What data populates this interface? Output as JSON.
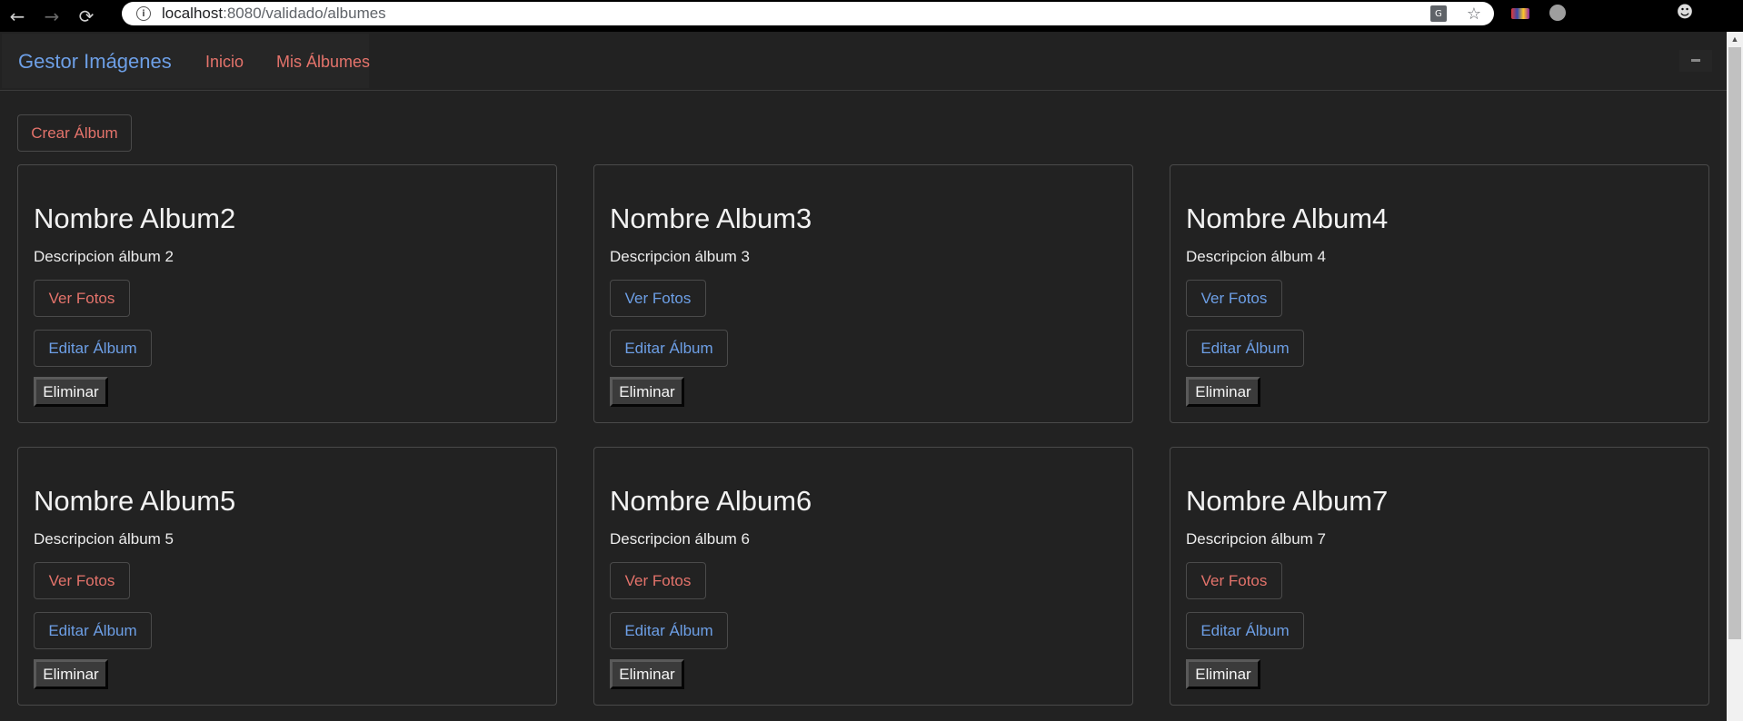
{
  "browser": {
    "back_icon": "←",
    "forward_icon": "→",
    "reload_icon": "⟳",
    "url_host": "localhost",
    "url_rest": ":8080/validado/albumes",
    "star_icon": "☆"
  },
  "navbar": {
    "brand": "Gestor Imágenes",
    "links": [
      "Inicio",
      "Mis Álbumes"
    ]
  },
  "actions": {
    "create_album": "Crear Álbum"
  },
  "albums": [
    {
      "title": "Nombre Album2",
      "description": "Descripcion álbum 2",
      "ver_fotos": "Ver Fotos",
      "editar": "Editar Álbum",
      "eliminar": "Eliminar",
      "ver_color": "red"
    },
    {
      "title": "Nombre Album3",
      "description": "Descripcion álbum 3",
      "ver_fotos": "Ver Fotos",
      "editar": "Editar Álbum",
      "eliminar": "Eliminar",
      "ver_color": "blue"
    },
    {
      "title": "Nombre Album4",
      "description": "Descripcion álbum 4",
      "ver_fotos": "Ver Fotos",
      "editar": "Editar Álbum",
      "eliminar": "Eliminar",
      "ver_color": "blue"
    },
    {
      "title": "Nombre Album5",
      "description": "Descripcion álbum 5",
      "ver_fotos": "Ver Fotos",
      "editar": "Editar Álbum",
      "eliminar": "Eliminar",
      "ver_color": "red"
    },
    {
      "title": "Nombre Album6",
      "description": "Descripcion álbum 6",
      "ver_fotos": "Ver Fotos",
      "editar": "Editar Álbum",
      "eliminar": "Eliminar",
      "ver_color": "red"
    },
    {
      "title": "Nombre Album7",
      "description": "Descripcion álbum 7",
      "ver_fotos": "Ver Fotos",
      "editar": "Editar Álbum",
      "eliminar": "Eliminar",
      "ver_color": "red"
    }
  ],
  "colors": {
    "background": "#222222",
    "link_red": "#e4736b",
    "link_blue": "#6d9fe6"
  }
}
